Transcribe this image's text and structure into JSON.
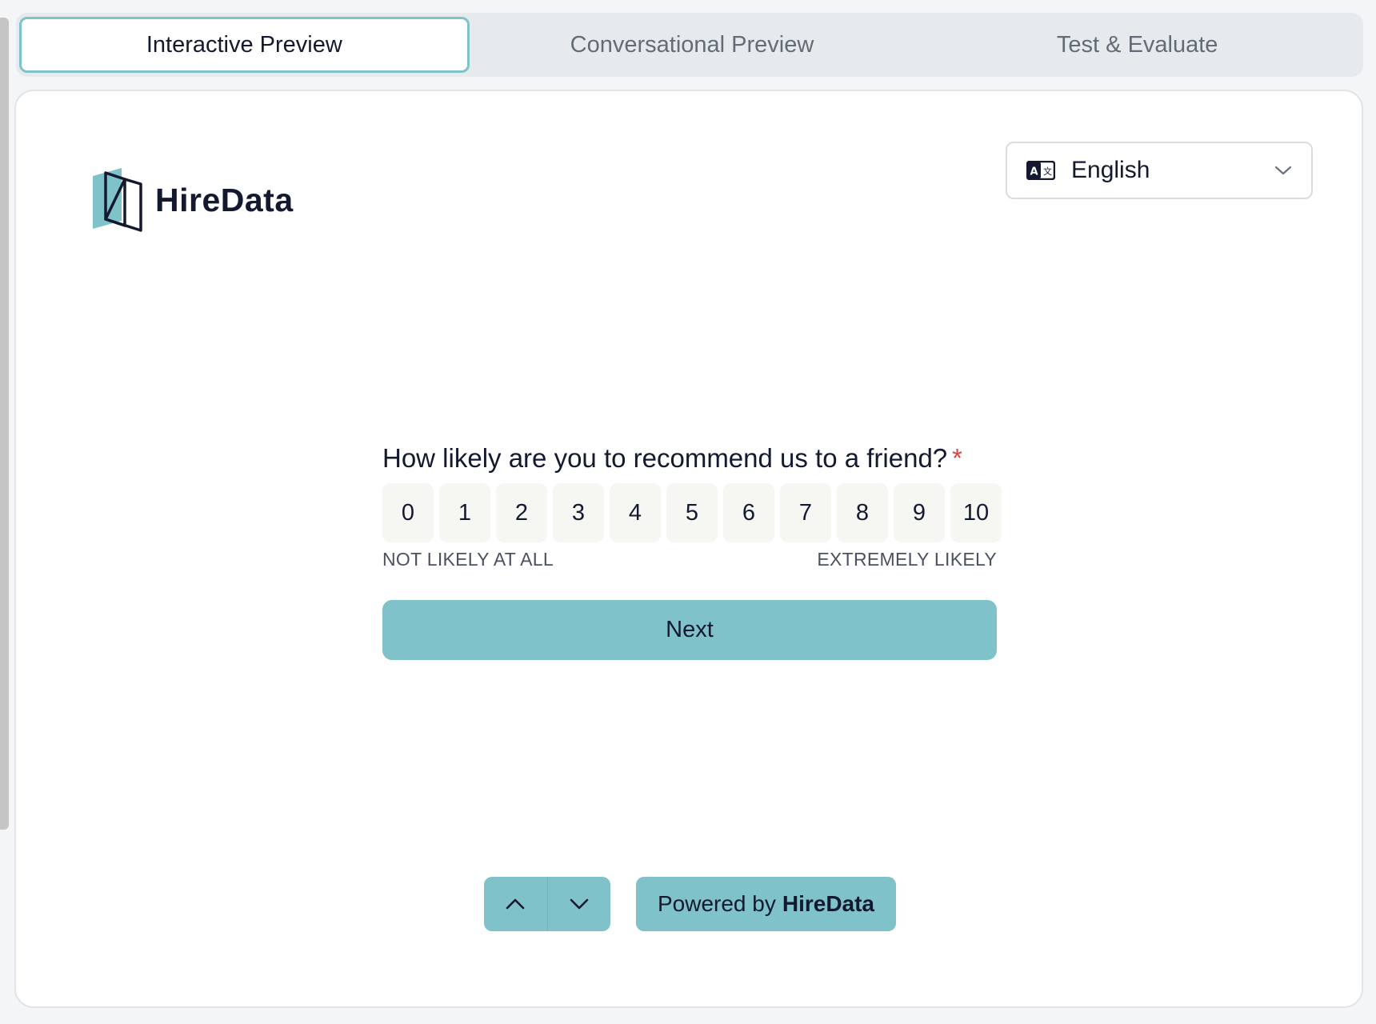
{
  "tabs": [
    {
      "label": "Interactive Preview",
      "active": true
    },
    {
      "label": "Conversational Preview",
      "active": false
    },
    {
      "label": "Test & Evaluate",
      "active": false
    }
  ],
  "brand": {
    "name": "HireData",
    "accent_color": "#7fc2c9"
  },
  "language": {
    "selected": "English",
    "icon": "translate-icon"
  },
  "question": {
    "text": "How likely are you to recommend us to a friend?",
    "required_marker": "*"
  },
  "scale": {
    "options": [
      "0",
      "1",
      "2",
      "3",
      "4",
      "5",
      "6",
      "7",
      "8",
      "9",
      "10"
    ],
    "low_label": "NOT LIKELY AT ALL",
    "high_label": "EXTREMELY LIKELY"
  },
  "actions": {
    "next_label": "Next"
  },
  "footer": {
    "nav_up_icon": "chevron-up-icon",
    "nav_down_icon": "chevron-down-icon",
    "powered_prefix": "Powered by",
    "powered_brand": "HireData"
  }
}
